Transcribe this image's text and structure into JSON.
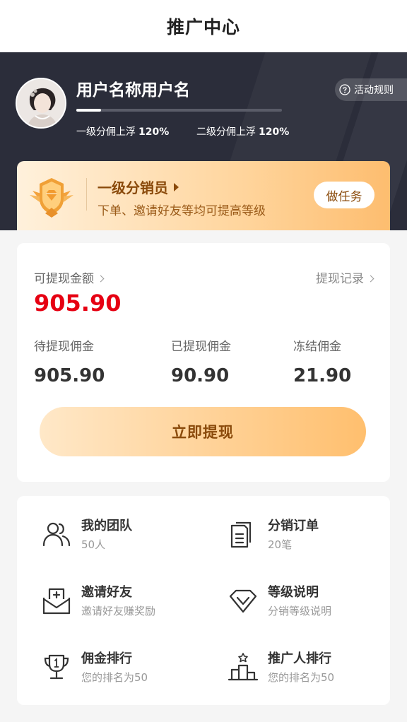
{
  "header": {
    "title": "推广中心"
  },
  "profile": {
    "username": "用户名称用户名",
    "level_progress": 0.12,
    "rates": [
      {
        "label": "一级分佣上浮",
        "value": "120%"
      },
      {
        "label": "二级分佣上浮",
        "value": "120%"
      }
    ],
    "rules_label": "活动规则"
  },
  "level": {
    "name": "一级分销员",
    "description": "下单、邀请好友等均可提高等级",
    "task_button": "做任务"
  },
  "wallet": {
    "available_label": "可提现金额",
    "available_amount": "905.90",
    "record_label": "提现记录",
    "stats": [
      {
        "label": "待提现佣金",
        "value": "905.90"
      },
      {
        "label": "已提现佣金",
        "value": "90.90"
      },
      {
        "label": "冻结佣金",
        "value": "21.90"
      }
    ],
    "withdraw_button": "立即提现"
  },
  "menu": {
    "items": [
      {
        "title": "我的团队",
        "subtitle": "50人",
        "icon": "team-icon"
      },
      {
        "title": "分销订单",
        "subtitle": "20笔",
        "icon": "orders-icon"
      },
      {
        "title": "邀请好友",
        "subtitle": "邀请好友赚奖励",
        "icon": "invite-icon"
      },
      {
        "title": "等级说明",
        "subtitle": "分销等级说明",
        "icon": "diamond-icon"
      },
      {
        "title": "佣金排行",
        "subtitle": "您的排名为50",
        "icon": "trophy-icon"
      },
      {
        "title": "推广人排行",
        "subtitle": "您的排名为50",
        "icon": "podium-icon"
      }
    ]
  },
  "colors": {
    "accent": "#e60012",
    "gold": "#8a4a0b",
    "hero_bg": "#2b2d3a"
  }
}
